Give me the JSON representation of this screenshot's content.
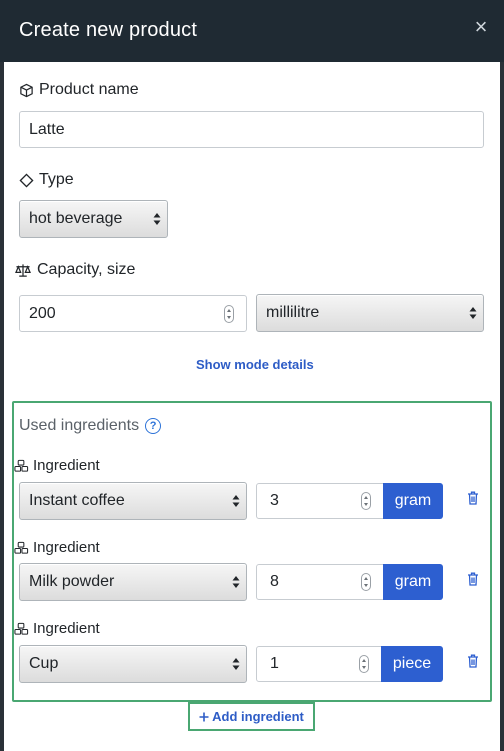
{
  "modal": {
    "title": "Create new product",
    "close_symbol": "×"
  },
  "product_name": {
    "label": "Product name",
    "value": "Latte"
  },
  "type": {
    "label": "Type",
    "selected": "hot beverage"
  },
  "capacity": {
    "label": "Capacity, size",
    "value": "200",
    "unit_selected": "millilitre"
  },
  "show_more_label": "Show mode details",
  "ingredients": {
    "title": "Used ingredients",
    "help_symbol": "?",
    "items": [
      {
        "label": "Ingredient",
        "name": "Instant coffee",
        "quantity": "3",
        "unit": "gram"
      },
      {
        "label": "Ingredient",
        "name": "Milk powder",
        "quantity": "8",
        "unit": "gram"
      },
      {
        "label": "Ingredient",
        "name": "Cup",
        "quantity": "1",
        "unit": "piece"
      }
    ]
  },
  "add_ingredient_label": "Add ingredient",
  "colors": {
    "header_bg": "#1f2a33",
    "accent_blue": "#2d5fd0",
    "highlight_green": "#4aa772"
  }
}
